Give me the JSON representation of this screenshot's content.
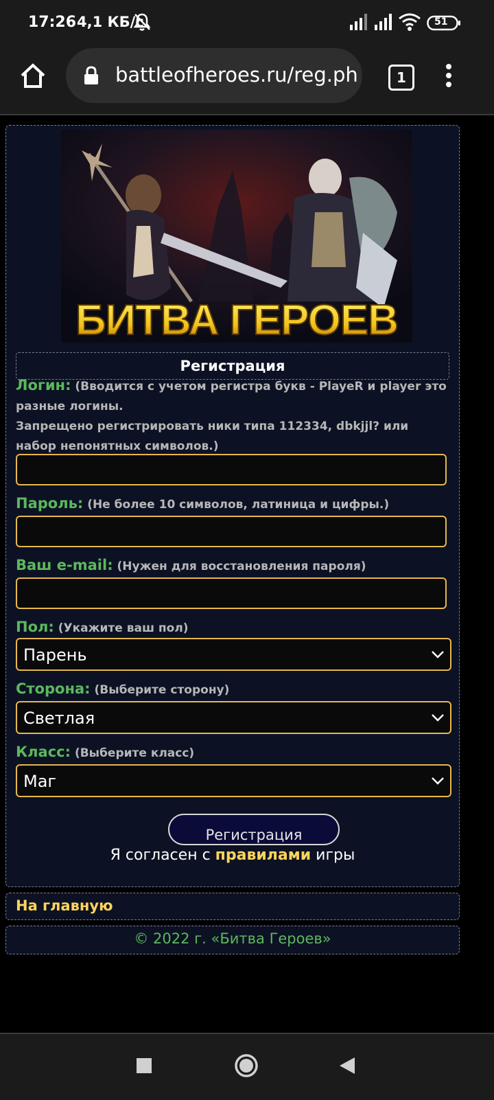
{
  "status": {
    "time": "17:26",
    "speed": "4,1 КБ/с",
    "battery": "51"
  },
  "browser": {
    "url": "battleofheroes.ru/reg.ph",
    "tab_count": "1"
  },
  "banner": {
    "logo_text": "БИТВА ГЕРОЕВ"
  },
  "form": {
    "title": "Регистрация",
    "login": {
      "label": "Логин:",
      "hint_line1": "(Вводится с учетом регистра букв - PlayeR и player это разные логины.",
      "hint_line2": "Запрещено регистрировать ники типа 112334, dbkjjl? или набор непонятных символов.)",
      "value": ""
    },
    "password": {
      "label": "Пароль:",
      "hint": "(Не более 10 символов, латиница и цифры.)",
      "value": ""
    },
    "email": {
      "label": "Ваш e-mail:",
      "hint": "(Нужен для восстановления пароля)",
      "value": ""
    },
    "gender": {
      "label": "Пол:",
      "hint": "(Укажите ваш пол)",
      "selected": "Парень"
    },
    "side": {
      "label": "Сторона:",
      "hint": "(Выберите сторону)",
      "selected": "Светлая"
    },
    "class": {
      "label": "Класс:",
      "hint": "(Выберите класс)",
      "selected": "Маг"
    },
    "submit_label": "Регистрация",
    "agree_prefix": "Я согласен с",
    "agree_link": "правилами",
    "agree_suffix": "игры"
  },
  "nav": {
    "home_link": "На главную"
  },
  "footer": {
    "copyright": "© 2022 г. «Битва Героев»"
  },
  "colors": {
    "label_green": "#5cb85c",
    "accent_gold": "#e8b84a",
    "link_yellow": "#ffd45a",
    "panel_bg": "#0c1224"
  }
}
